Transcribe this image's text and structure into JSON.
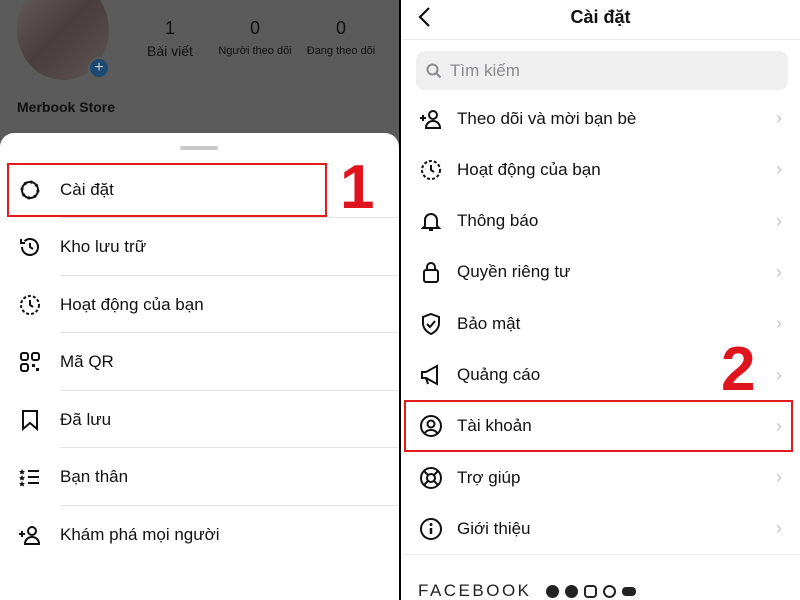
{
  "profile": {
    "name": "Merbook Store",
    "stats": [
      {
        "value": "1",
        "label": "Bài viết"
      },
      {
        "value": "0",
        "label": "Người theo dõi"
      },
      {
        "value": "0",
        "label": "Đang theo dõi"
      }
    ]
  },
  "menu": {
    "items": [
      {
        "label": "Cài đặt",
        "icon": "gear-icon"
      },
      {
        "label": "Kho lưu trữ",
        "icon": "archive-icon"
      },
      {
        "label": "Hoạt động của bạn",
        "icon": "activity-icon"
      },
      {
        "label": "Mã QR",
        "icon": "qr-icon"
      },
      {
        "label": "Đã lưu",
        "icon": "bookmark-icon"
      },
      {
        "label": "Bạn thân",
        "icon": "close-friends-icon"
      },
      {
        "label": "Khám phá mọi người",
        "icon": "add-person-icon"
      }
    ]
  },
  "annotations": {
    "step1": "1",
    "step2": "2",
    "highlight_color": "#e21b1b"
  },
  "settings": {
    "title": "Cài đặt",
    "search_placeholder": "Tìm kiếm",
    "items": [
      {
        "label": "Theo dõi và mời bạn bè",
        "icon": "add-person-icon"
      },
      {
        "label": "Hoạt động của bạn",
        "icon": "activity-icon"
      },
      {
        "label": "Thông báo",
        "icon": "bell-icon"
      },
      {
        "label": "Quyền riêng tư",
        "icon": "lock-icon"
      },
      {
        "label": "Bảo mật",
        "icon": "shield-icon"
      },
      {
        "label": "Quảng cáo",
        "icon": "megaphone-icon"
      },
      {
        "label": "Tài khoản",
        "icon": "account-icon"
      },
      {
        "label": "Trợ giúp",
        "icon": "lifebuoy-icon"
      },
      {
        "label": "Giới thiệu",
        "icon": "info-icon"
      }
    ],
    "footer": "FACEBOOK"
  }
}
